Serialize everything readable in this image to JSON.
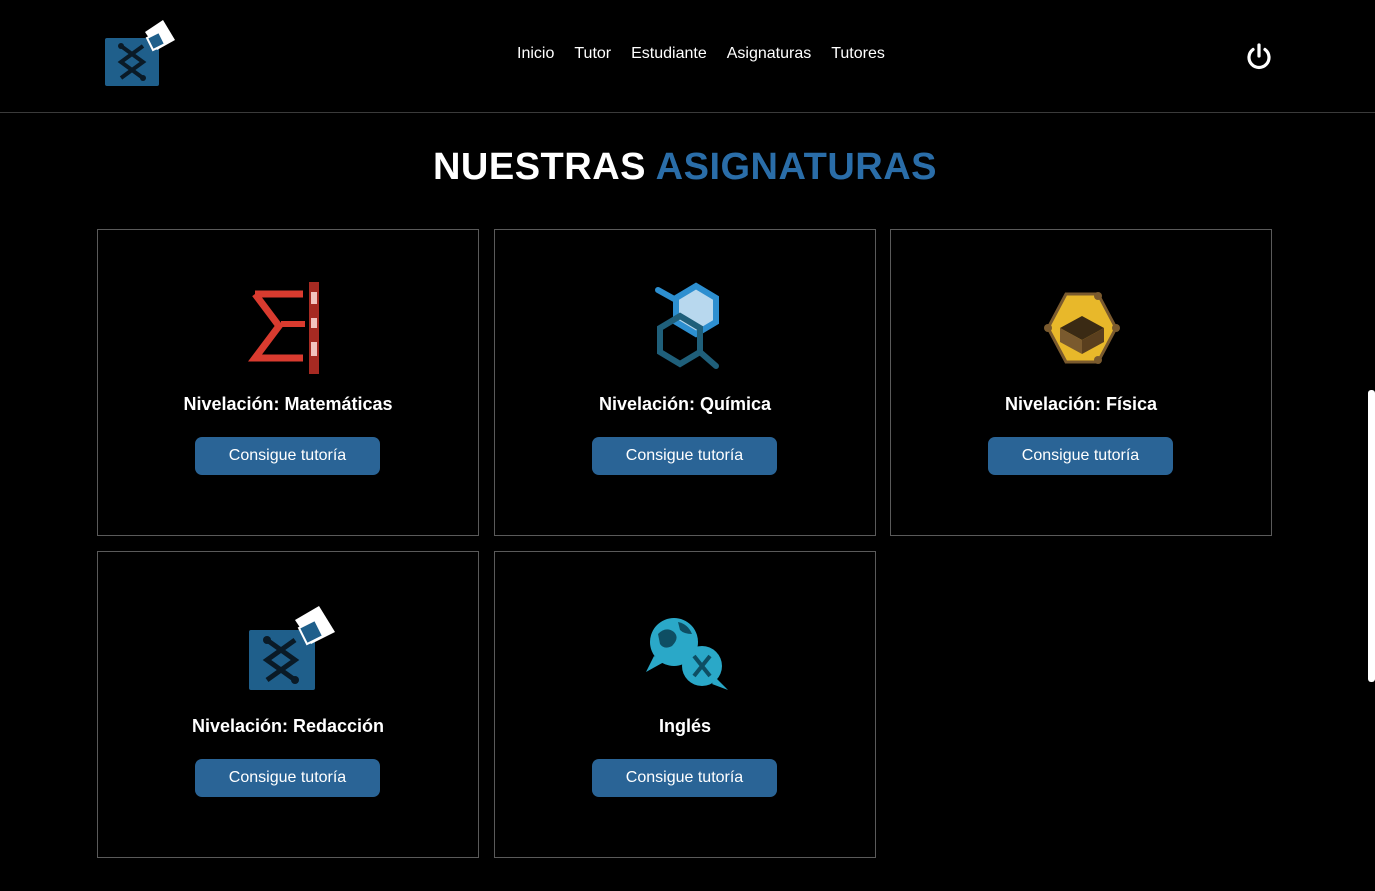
{
  "nav": {
    "links": [
      "Inicio",
      "Tutor",
      "Estudiante",
      "Asignaturas",
      "Tutores"
    ],
    "logout_icon": "power-icon",
    "logo_icon": "graduation-logo-icon"
  },
  "heading": {
    "white": "NUESTRAS",
    "accent": "ASIGNATURAS",
    "accent_color": "#2a6da8"
  },
  "button_color": "#2a6496",
  "cards": [
    {
      "title": "Nivelación: Matemáticas",
      "button": "Consigue tutoría",
      "icon": "math-sigma-icon"
    },
    {
      "title": "Nivelación: Química",
      "button": "Consigue tutoría",
      "icon": "chemistry-hexagon-icon"
    },
    {
      "title": "Nivelación: Física",
      "button": "Consigue tutoría",
      "icon": "physics-cube-icon"
    },
    {
      "title": "Nivelación: Redacción",
      "button": "Consigue tutoría",
      "icon": "graduation-logo-icon"
    },
    {
      "title": "Inglés",
      "button": "Consigue tutoría",
      "icon": "language-globe-icon"
    }
  ]
}
